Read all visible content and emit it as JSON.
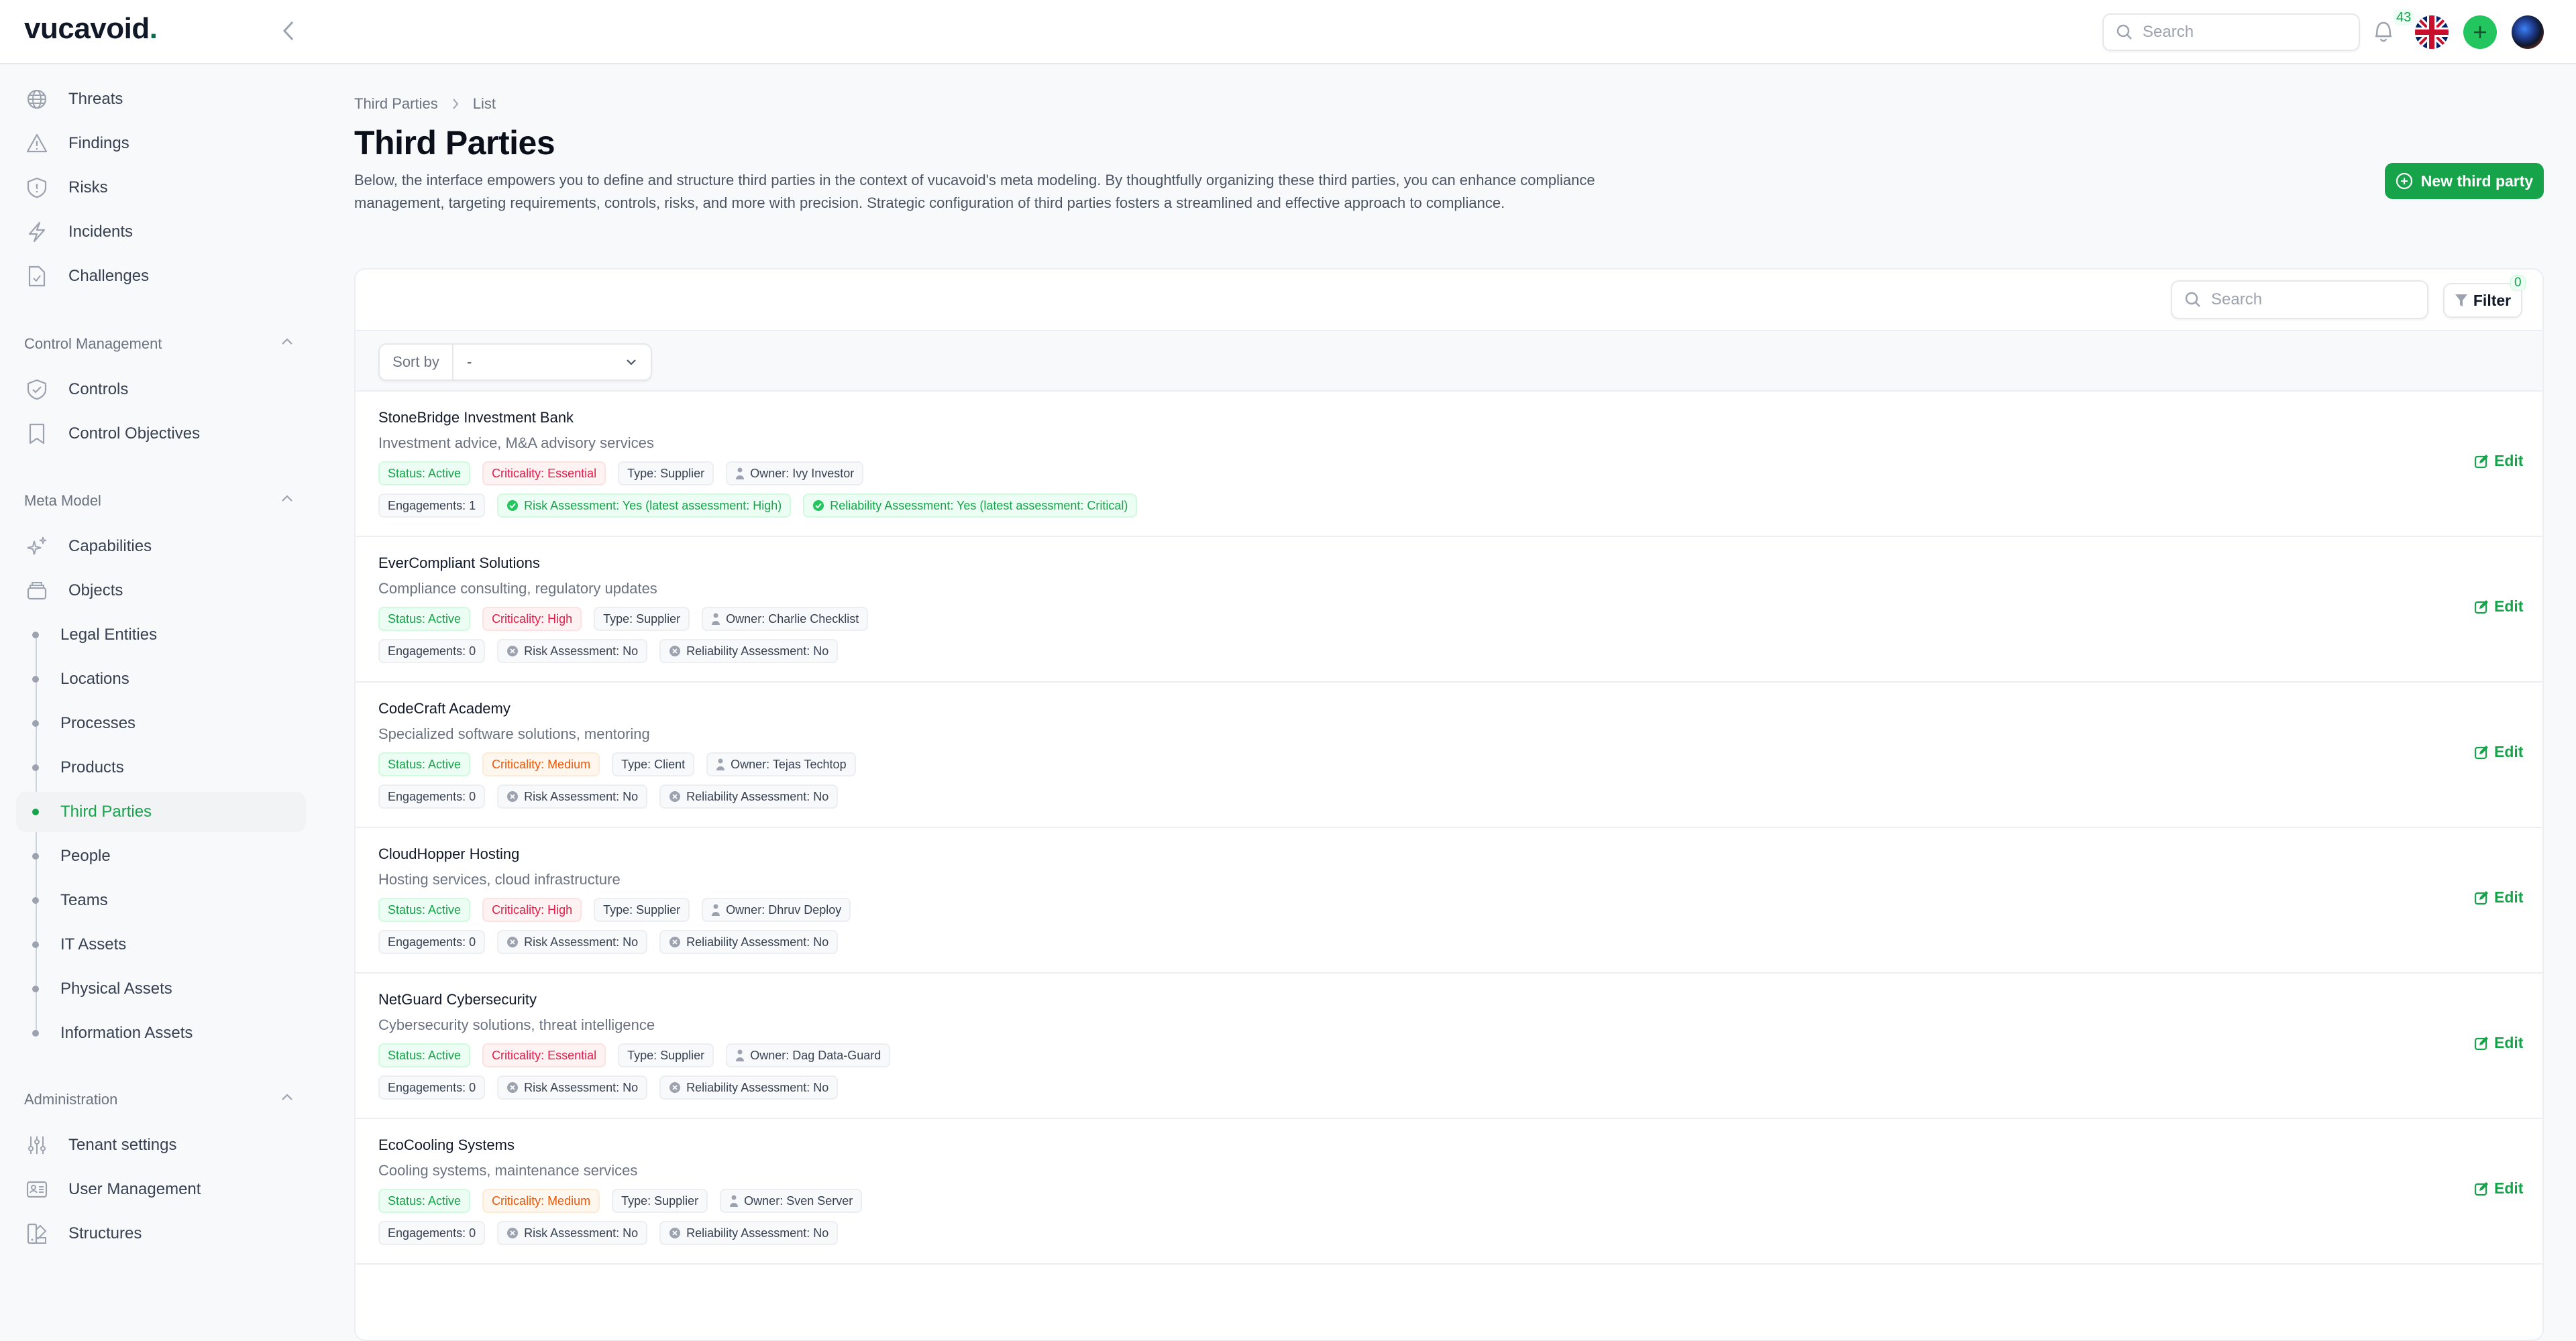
{
  "header": {
    "logo": "vucavoid",
    "logo_dot": ".",
    "search_placeholder": "Search",
    "notification_count": "43"
  },
  "sidebar": {
    "top_items": [
      {
        "label": "Threats",
        "icon": "globe-icon"
      },
      {
        "label": "Findings",
        "icon": "warning-triangle-icon"
      },
      {
        "label": "Risks",
        "icon": "shield-alert-icon"
      },
      {
        "label": "Incidents",
        "icon": "lightning-icon"
      },
      {
        "label": "Challenges",
        "icon": "file-check-icon"
      }
    ],
    "sections": [
      {
        "title": "Control Management",
        "items": [
          {
            "label": "Controls",
            "icon": "shield-check-icon"
          },
          {
            "label": "Control Objectives",
            "icon": "bookmark-icon"
          }
        ]
      },
      {
        "title": "Meta Model",
        "items": [
          {
            "label": "Capabilities",
            "icon": "sparkles-icon"
          },
          {
            "label": "Objects",
            "icon": "stack-icon"
          }
        ],
        "sub_items": [
          "Legal Entities",
          "Locations",
          "Processes",
          "Products",
          "Third Parties",
          "People",
          "Teams",
          "IT Assets",
          "Physical Assets",
          "Information Assets"
        ],
        "active_sub": "Third Parties"
      },
      {
        "title": "Administration",
        "items": [
          {
            "label": "Tenant settings",
            "icon": "sliders-icon"
          },
          {
            "label": "User Management",
            "icon": "id-card-icon"
          },
          {
            "label": "Structures",
            "icon": "swatch-icon"
          }
        ]
      }
    ]
  },
  "page": {
    "breadcrumb": [
      "Third Parties",
      "List"
    ],
    "title": "Third Parties",
    "description": "Below, the interface empowers you to define and structure third parties in the context of vucavoid's meta modeling. By thoughtfully organizing these third parties, you can enhance compliance management, targeting requirements, controls, risks, and more with precision. Strategic configuration of third parties fosters a streamlined and effective approach to compliance.",
    "new_button": "New third party"
  },
  "list": {
    "search_placeholder": "Search",
    "filter_label": "Filter",
    "filter_count": "0",
    "sort_label": "Sort by",
    "sort_value": "-",
    "edit_label": "Edit",
    "rows": [
      {
        "name": "StoneBridge Investment Bank",
        "description": "Investment advice, M&A advisory services",
        "status": "Status: Active",
        "criticality": "Criticality: Essential",
        "criticality_level": "red",
        "type": "Type: Supplier",
        "owner": "Owner: Ivy Investor",
        "engagements": "Engagements: 1",
        "risk": "Risk Assessment: Yes (latest assessment: High)",
        "risk_done": true,
        "reliability": "Reliability Assessment: Yes (latest assessment: Critical)",
        "reliability_done": true
      },
      {
        "name": "EverCompliant Solutions",
        "description": "Compliance consulting, regulatory updates",
        "status": "Status: Active",
        "criticality": "Criticality: High",
        "criticality_level": "red",
        "type": "Type: Supplier",
        "owner": "Owner: Charlie Checklist",
        "engagements": "Engagements: 0",
        "risk": "Risk Assessment: No",
        "risk_done": false,
        "reliability": "Reliability Assessment: No",
        "reliability_done": false
      },
      {
        "name": "CodeCraft Academy",
        "description": "Specialized software solutions, mentoring",
        "status": "Status: Active",
        "criticality": "Criticality: Medium",
        "criticality_level": "orange",
        "type": "Type: Client",
        "owner": "Owner: Tejas Techtop",
        "engagements": "Engagements: 0",
        "risk": "Risk Assessment: No",
        "risk_done": false,
        "reliability": "Reliability Assessment: No",
        "reliability_done": false
      },
      {
        "name": "CloudHopper Hosting",
        "description": "Hosting services, cloud infrastructure",
        "status": "Status: Active",
        "criticality": "Criticality: High",
        "criticality_level": "red",
        "type": "Type: Supplier",
        "owner": "Owner: Dhruv Deploy",
        "engagements": "Engagements: 0",
        "risk": "Risk Assessment: No",
        "risk_done": false,
        "reliability": "Reliability Assessment: No",
        "reliability_done": false
      },
      {
        "name": "NetGuard Cybersecurity",
        "description": "Cybersecurity solutions, threat intelligence",
        "status": "Status: Active",
        "criticality": "Criticality: Essential",
        "criticality_level": "red",
        "type": "Type: Supplier",
        "owner": "Owner: Dag Data-Guard",
        "engagements": "Engagements: 0",
        "risk": "Risk Assessment: No",
        "risk_done": false,
        "reliability": "Reliability Assessment: No",
        "reliability_done": false
      },
      {
        "name": "EcoCooling Systems",
        "description": "Cooling systems, maintenance services",
        "status": "Status: Active",
        "criticality": "Criticality: Medium",
        "criticality_level": "orange",
        "type": "Type: Supplier",
        "owner": "Owner: Sven Server",
        "engagements": "Engagements: 0",
        "risk": "Risk Assessment: No",
        "risk_done": false,
        "reliability": "Reliability Assessment: No",
        "reliability_done": false
      }
    ]
  },
  "colors": {
    "brand": "#16a34a",
    "critical": "#e11d48",
    "medium": "#ea580c"
  }
}
